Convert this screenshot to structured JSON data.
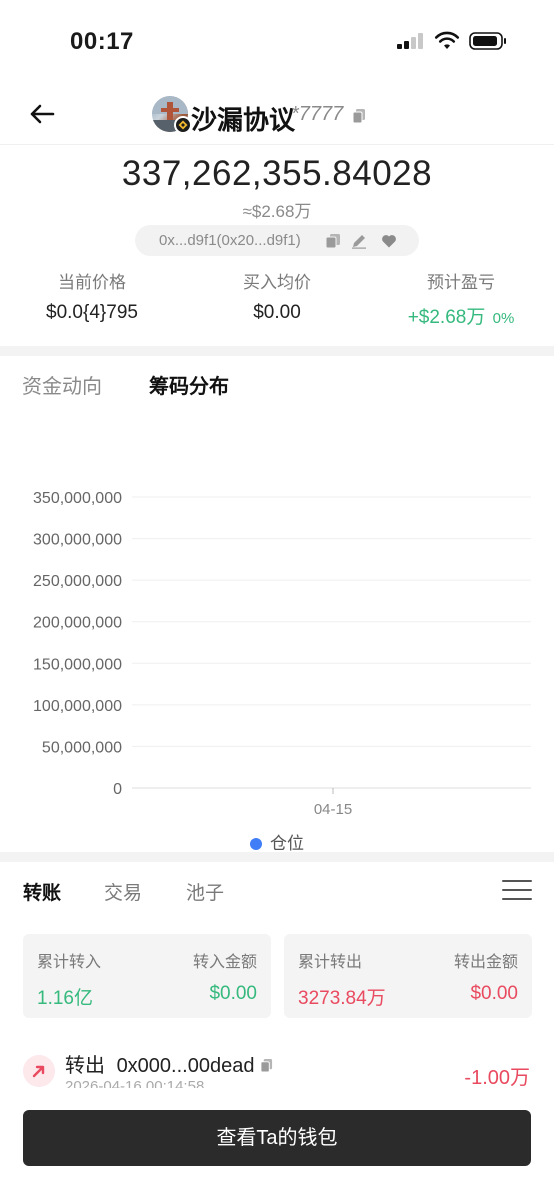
{
  "status_bar": {
    "time": "00:17"
  },
  "header": {
    "token_name": "沙漏协议",
    "token_suffix": "*7777"
  },
  "balance": {
    "amount": "337,262,355.84028",
    "usd": "≈$2.68万"
  },
  "address_pill": {
    "text": "0x...d9f1(0x20...d9f1)"
  },
  "stats": [
    {
      "label": "当前价格",
      "value": "$0.0{4}795"
    },
    {
      "label": "买入均价",
      "value": "$0.00"
    },
    {
      "label": "预计盈亏",
      "value": "+$2.68万",
      "pct": "0%"
    }
  ],
  "tabs_top": {
    "fund_flow": "资金动向",
    "chip_dist": "筹码分布"
  },
  "chart_data": {
    "type": "line",
    "x": [
      "04-15"
    ],
    "series": [
      {
        "name": "仓位",
        "values": [
          0
        ]
      }
    ],
    "ylim": [
      0,
      350000000
    ],
    "yticks": [
      "0",
      "50,000,000",
      "100,000,000",
      "150,000,000",
      "200,000,000",
      "250,000,000",
      "300,000,000",
      "350,000,000"
    ],
    "ytick_values": [
      0,
      50000000,
      100000000,
      150000000,
      200000000,
      250000000,
      300000000,
      350000000
    ],
    "xticks": [
      "04-15"
    ],
    "grid": true,
    "legend": "bottom",
    "colors": {
      "series": "#3f7ef6",
      "grid": "#efefef"
    }
  },
  "legend_label": "仓位",
  "tabs_bottom": {
    "transfer": "转账",
    "trade": "交易",
    "pool": "池子"
  },
  "cards": {
    "in": {
      "label_left": "累计转入",
      "label_right": "转入金额",
      "value_left": "1.16亿",
      "value_right": "$0.00"
    },
    "out": {
      "label_left": "累计转出",
      "label_right": "转出金额",
      "value_left": "3273.84万",
      "value_right": "$0.00"
    }
  },
  "transaction": {
    "type": "转出",
    "address": "0x000...00dead",
    "time": "2026-04-16 00:14:58",
    "amount": "-1.00万"
  },
  "wallet_button": "查看Ta的钱包",
  "colors": {
    "green": "#35b97d",
    "red": "#e94a5f",
    "accent_blue": "#3f7ef6",
    "button_bg": "#2b2b2b"
  }
}
